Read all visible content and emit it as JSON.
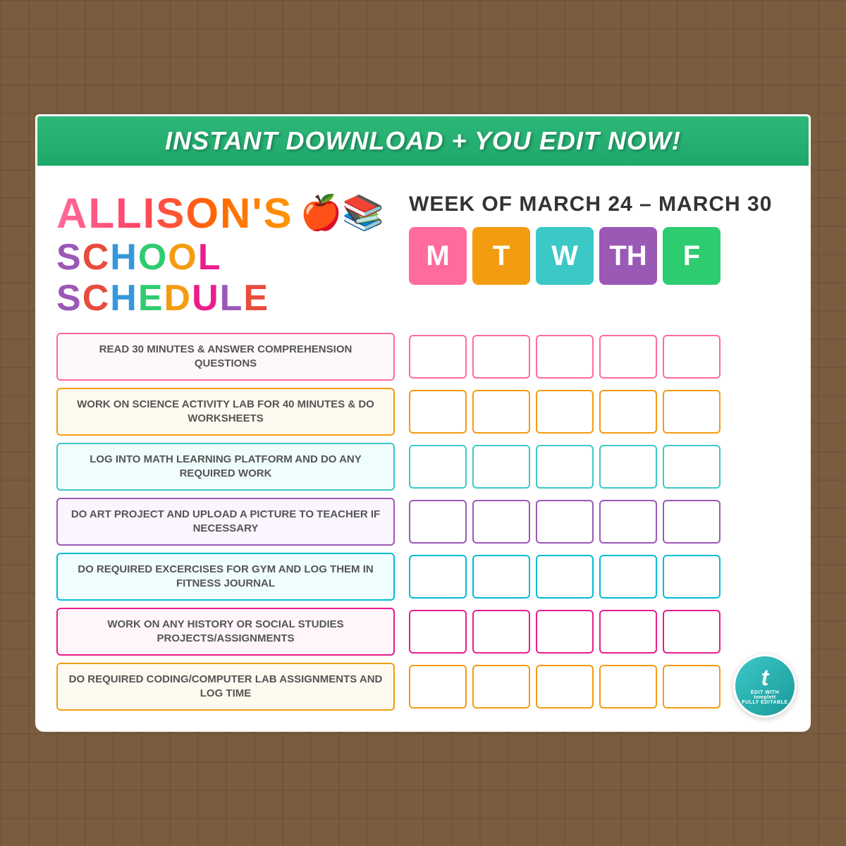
{
  "banner": {
    "text": "INSTANT DOWNLOAD + YOU EDIT NOW!"
  },
  "header": {
    "name": "ALLISON'S",
    "title_line1": "SCHOOL SCHEDULE",
    "week_label": "WEEK OF MARCH 24 – MARCH 30",
    "days": [
      {
        "label": "M",
        "color_class": "day-mon"
      },
      {
        "label": "T",
        "color_class": "day-tue"
      },
      {
        "label": "W",
        "color_class": "day-wed"
      },
      {
        "label": "TH",
        "color_class": "day-thu"
      },
      {
        "label": "F",
        "color_class": "day-fri"
      }
    ]
  },
  "tasks": [
    {
      "text": "READ 30 MINUTES & ANSWER COMPREHENSION QUESTIONS",
      "style": "task-pink",
      "cb_style": "cb-pink"
    },
    {
      "text": "WORK ON SCIENCE ACTIVITY LAB FOR 40 MINUTES & DO WORKSHEETS",
      "style": "task-orange",
      "cb_style": "cb-orange"
    },
    {
      "text": "LOG INTO MATH LEARNING PLATFORM AND DO ANY REQUIRED WORK",
      "style": "task-teal",
      "cb_style": "cb-teal"
    },
    {
      "text": "DO ART PROJECT AND UPLOAD A PICTURE TO TEACHER IF NECESSARY",
      "style": "task-purple",
      "cb_style": "cb-purple"
    },
    {
      "text": "DO REQUIRED EXCERCISES FOR GYM AND LOG THEM IN FITNESS JOURNAL",
      "style": "task-cyan",
      "cb_style": "cb-cyan"
    },
    {
      "text": "WORK ON ANY HISTORY OR SOCIAL STUDIES PROJECTS/ASSIGNMENTS",
      "style": "task-hotpink",
      "cb_style": "cb-hotpink"
    },
    {
      "text": "DO REQUIRED CODING/COMPUTER LAB ASSIGNMENTS AND LOG TIME",
      "style": "task-gold",
      "cb_style": "cb-gold"
    }
  ],
  "templett": {
    "letter": "t",
    "line1": "EDIT WITH",
    "line2": "templett",
    "line3": "FULLY EDITABLE TEMPLATE"
  }
}
